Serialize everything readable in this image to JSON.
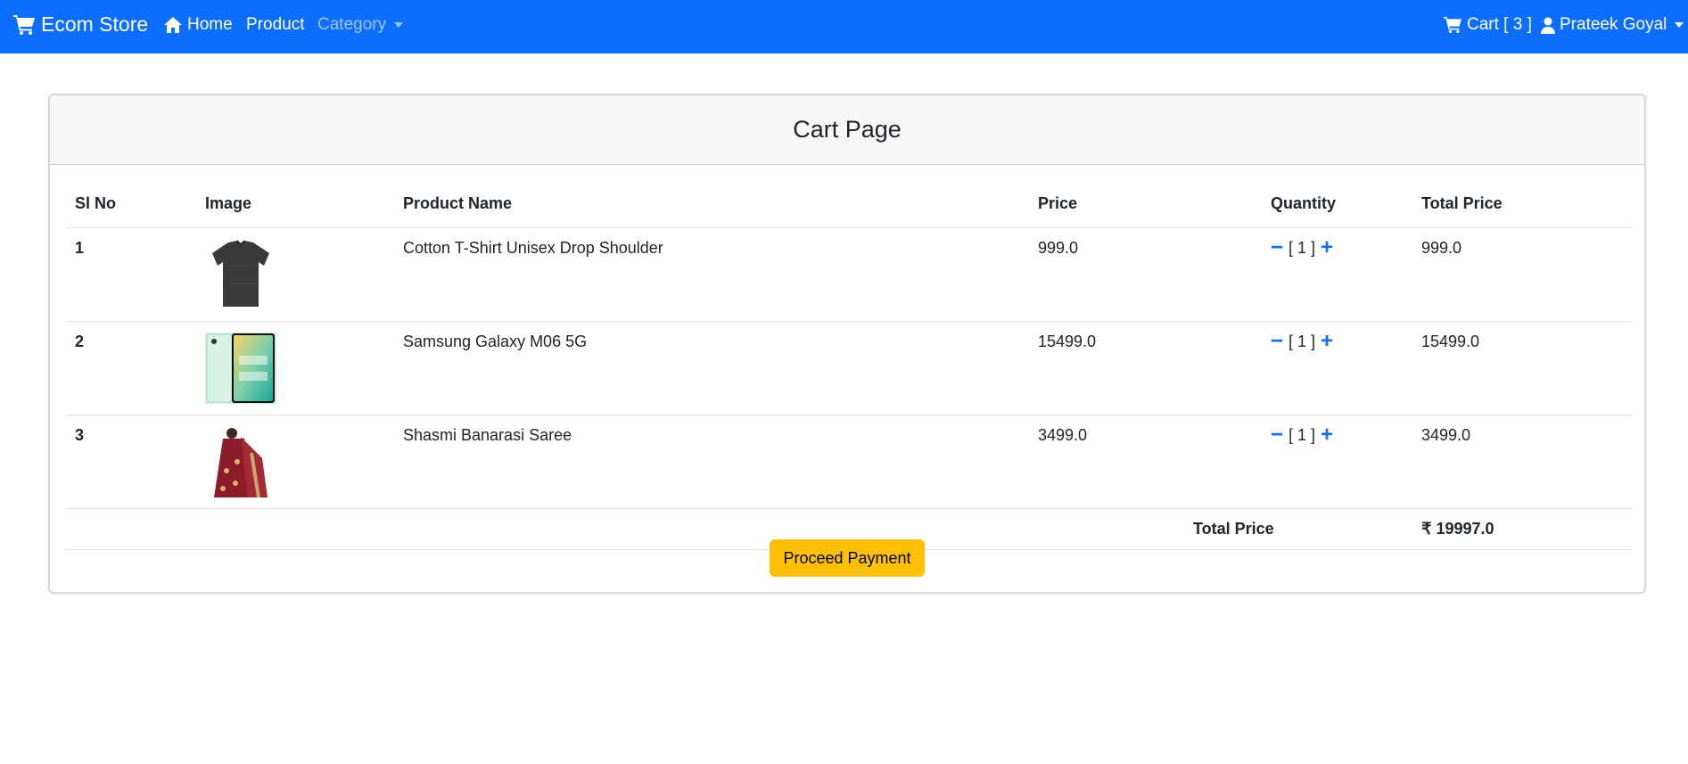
{
  "navbar": {
    "brand": "Ecom Store",
    "home": "Home",
    "product": "Product",
    "category": "Category",
    "cart": "Cart [ 3 ]",
    "user": "Prateek Goyal"
  },
  "card": {
    "title": "Cart Page"
  },
  "table": {
    "headers": [
      "Sl No",
      "Image",
      "Product Name",
      "Price",
      "Quantity",
      "Total Price"
    ],
    "rows": [
      {
        "sl": "1",
        "image": "black-tshirt-image",
        "name": "Cotton T-Shirt Unisex Drop Shoulder",
        "price": "999.0",
        "qty": "[ 1 ]",
        "total": "999.0"
      },
      {
        "sl": "2",
        "image": "phone-box-image",
        "name": "Samsung Galaxy M06 5G",
        "price": "15499.0",
        "qty": "[ 1 ]",
        "total": "15499.0"
      },
      {
        "sl": "3",
        "image": "saree-image",
        "name": "Shasmi Banarasi Saree",
        "price": "3499.0",
        "qty": "[ 1 ]",
        "total": "3499.0"
      }
    ],
    "total_label": "Total Price",
    "total_value": "₹ 19997.0",
    "qty_minus": "−",
    "qty_plus": "+"
  },
  "actions": {
    "proceed": "Proceed Payment"
  },
  "colors": {
    "navbar": "#0d6efd",
    "accent": "#0d6efd",
    "pay_button": "#ffc107"
  }
}
